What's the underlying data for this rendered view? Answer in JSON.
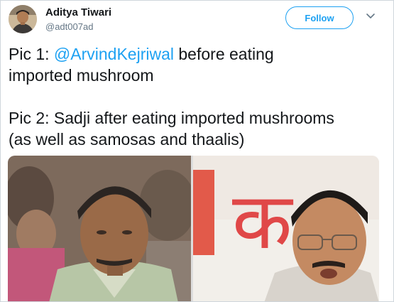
{
  "author": {
    "name": "Aditya Tiwari",
    "handle": "@adt007ad",
    "avatar_icon": "profile-photo"
  },
  "actions": {
    "follow_label": "Follow",
    "menu_icon": "chevron-down-icon"
  },
  "tweet": {
    "line1_prefix": "Pic 1: ",
    "line1_mention": "@ArvindKejriwal",
    "line1_suffix": " before eating",
    "line2": "imported mushroom",
    "line3": "Pic 2: Sadji after eating imported mushrooms",
    "line4": "(as well as samosas and thaalis)"
  },
  "media": {
    "left_photo": "photo-thin-man-in-crowd",
    "right_photo": "photo-man-with-glasses-speaking",
    "banner_text": "क"
  },
  "colors": {
    "accent": "#1da1f2",
    "text": "#14171a",
    "secondary": "#657786"
  }
}
